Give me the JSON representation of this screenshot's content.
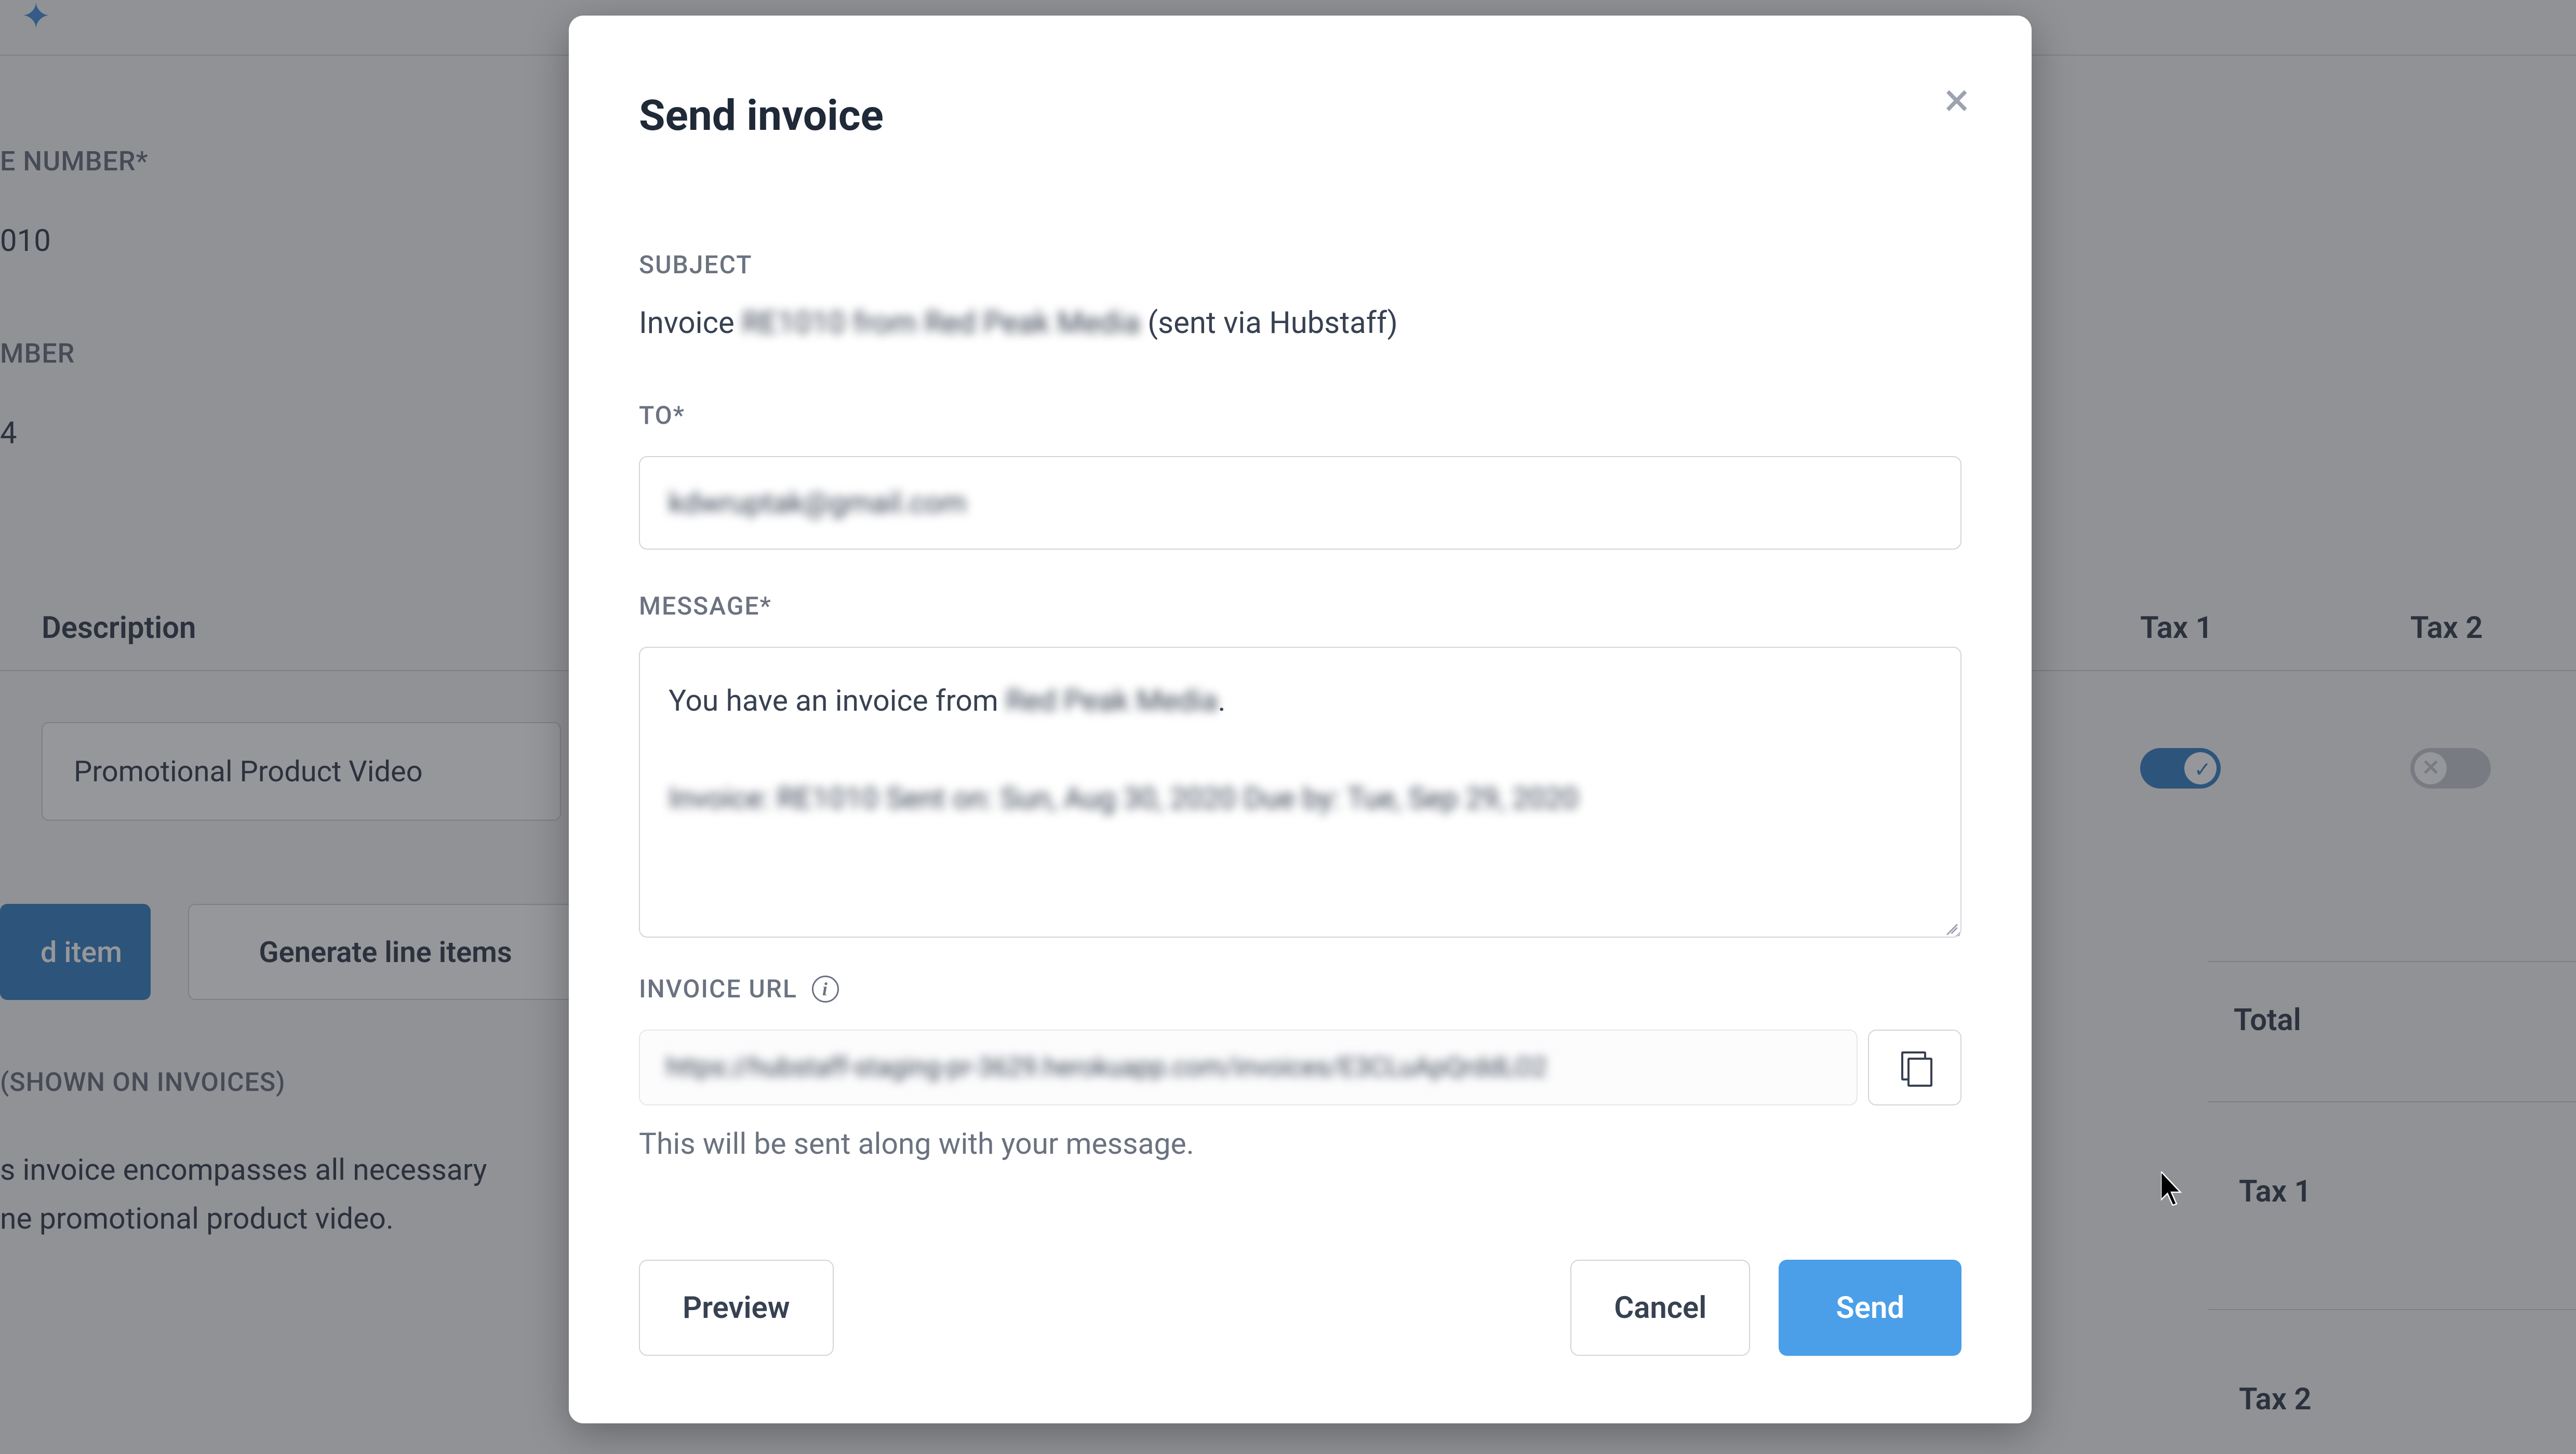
{
  "background": {
    "field1_label": "E NUMBER*",
    "field1_value": "010",
    "field2_label": "MBER",
    "field2_value": "4",
    "description_header": "Description",
    "description_value": "Promotional Product Video",
    "add_item_btn": "d item",
    "generate_btn": "Generate line items",
    "shown_label": "(SHOWN ON INVOICES)",
    "notes_line1": "s invoice encompasses all necessary ",
    "notes_line2": "ne promotional product video.",
    "tax1_header": "Tax 1",
    "tax2_header": "Tax 2",
    "total_label": "Total",
    "tax1_row": "Tax 1",
    "tax2_row": "Tax 2"
  },
  "modal": {
    "title": "Send invoice",
    "subject_label": "SUBJECT",
    "subject_prefix": "Invoice ",
    "subject_blurred": "RE1010 from Red Peak Media",
    "subject_suffix": " (sent via Hubstaff)",
    "to_label": "TO*",
    "to_value": "kdwruptak@gmail.com",
    "message_label": "MESSAGE*",
    "message_line1_prefix": "You have an invoice from ",
    "message_line1_blurred": "Red Peak Media",
    "message_line1_suffix": ".",
    "message_line2": "Invoice: RE1010",
    "message_line3": "Sent on: Sun, Aug 30, 2020",
    "message_line4": "Due by: Tue, Sep 29, 2020",
    "url_label": "INVOICE URL",
    "url_value": "https://hubstaff-staging-pr-3629.herokuapp.com/invoices/E3CLuApQrddLO2",
    "helper_text": "This will be sent along with your message.",
    "preview_btn": "Preview",
    "cancel_btn": "Cancel",
    "send_btn": "Send"
  }
}
